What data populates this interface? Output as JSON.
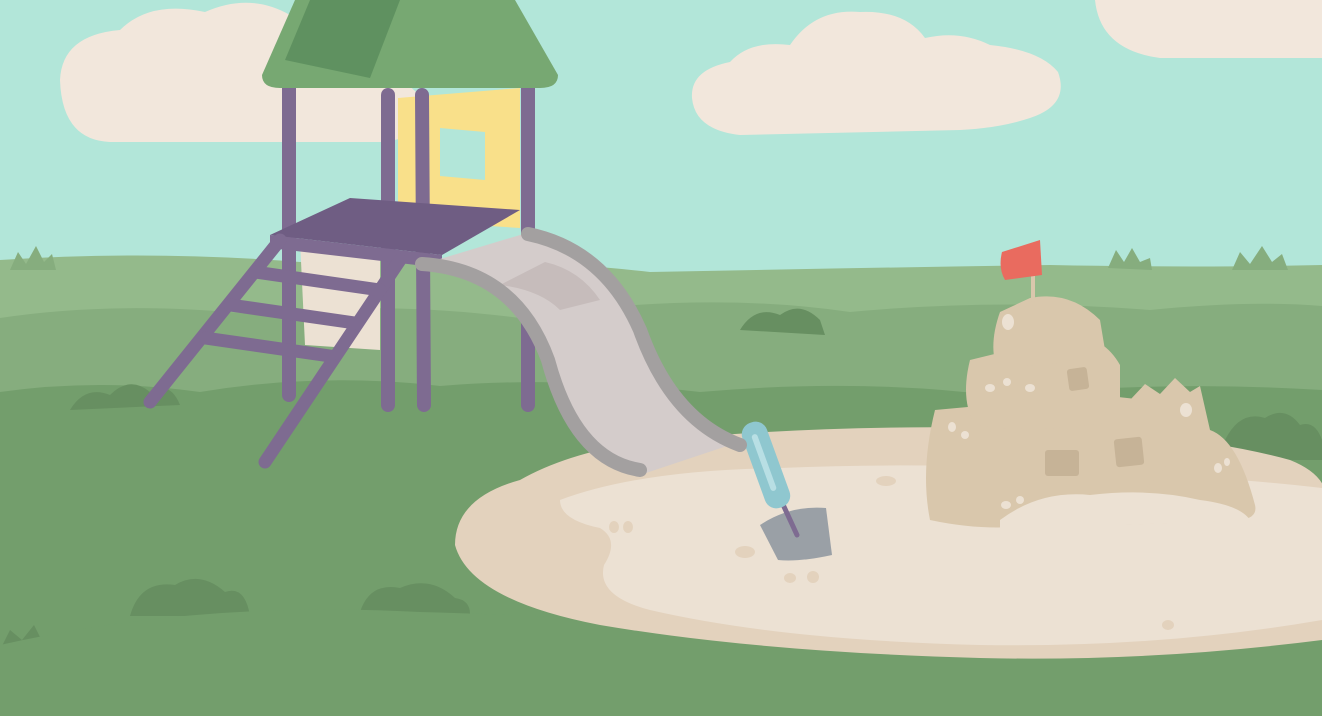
{
  "scene": {
    "palette": {
      "sky": "#b2e6d9",
      "cloud": "#f2e7dc",
      "hill_far": "#94ba8b",
      "hill_mid": "#86ad7e",
      "ground": "#739e6c",
      "bush_dark": "#678f61",
      "sand": "#ece1d3",
      "sand_shade": "#e3d2bd",
      "castle": "#d9c7ac",
      "castle_shade": "#c6b397",
      "flag": "#e96b5f",
      "roof": "#77a872",
      "roof_dark": "#5f9160",
      "tower_frame": "#7e6b91",
      "window_glow": "#f9e08a",
      "slide": "#d4cccb",
      "slide_rail": "#a3a0a0",
      "shovel_handle": "#8fc7cf",
      "shovel_blade": "#9aa0a6"
    }
  }
}
